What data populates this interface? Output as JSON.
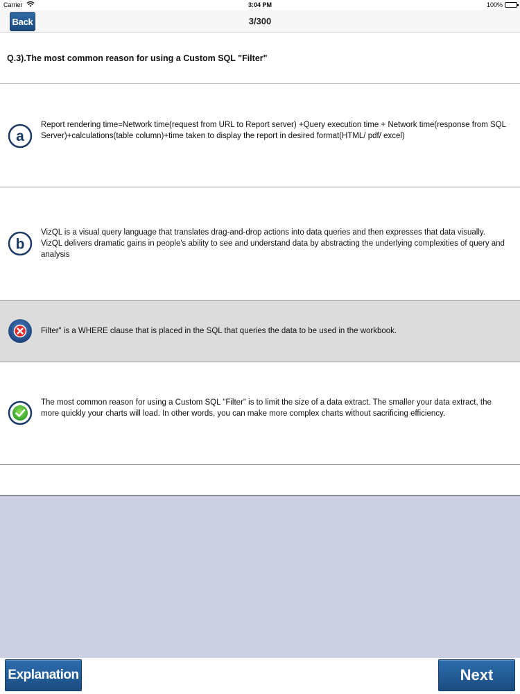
{
  "status_bar": {
    "carrier": "Carrier",
    "time": "3:04 PM",
    "battery_percent": "100%"
  },
  "nav": {
    "back_label": "Back",
    "progress": "3/300"
  },
  "question": {
    "text": "Q.3).The most common reason for using a Custom SQL \"Filter\""
  },
  "options": [
    {
      "badge": "a",
      "state": "default",
      "text": "Report rendering time=Network time(request from URL to Report server) +Query execution time + Network time(response from SQL Server)+calculations(table column)+time taken to display the report in desired format(HTML/ pdf/ excel)"
    },
    {
      "badge": "b",
      "state": "default",
      "text": "VizQL is a visual query language that translates drag-and-drop actions into data queries and then expresses that data visually. VizQL delivers dramatic gains in people's ability to see and understand data by abstracting the underlying complexities of query and analysis"
    },
    {
      "badge": "wrong-icon",
      "state": "wrong",
      "text": "Filter\" is a WHERE clause that is placed in the SQL that queries the data to be used in the workbook."
    },
    {
      "badge": "correct-icon",
      "state": "correct",
      "text": "The most common reason for using a Custom SQL \"Filter\" is to limit the size of a data extract. The smaller your data extract, the more quickly your charts will load. In other words, you can make more complex charts without sacrificing efficiency."
    }
  ],
  "bottom": {
    "explanation_label": "Explanation",
    "next_label": "Next"
  },
  "colors": {
    "button_blue": "#1d4f85",
    "wrong_row_bg": "#dcdcdc",
    "lower_area_bg": "#cdd0e2",
    "badge_navy": "#1b3a66"
  }
}
